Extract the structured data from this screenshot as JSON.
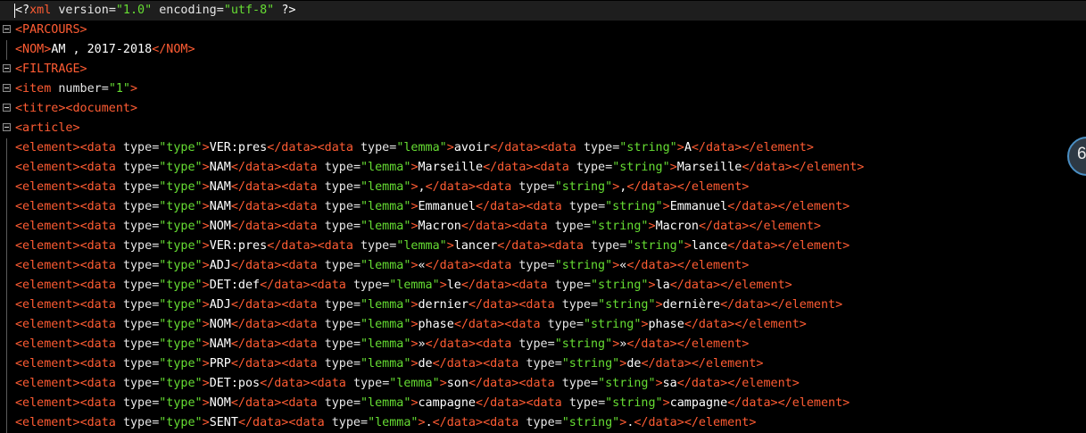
{
  "prolog": {
    "open": "<?",
    "name": "xml",
    "version_attr": "version",
    "version_val": "\"1.0\"",
    "encoding_attr": "encoding",
    "encoding_val": "\"utf-8\"",
    "close": "?>"
  },
  "parcours_tag": "<PARCOURS>",
  "nom_open": "<NOM>",
  "nom_text": "AM , 2017-2018",
  "nom_close": "</NOM>",
  "filtrage_tag": "<FILTRAGE>",
  "item": {
    "open": "<item",
    "attr": "number",
    "val": "\"1\"",
    "close": ">"
  },
  "titre_line": "<titre><document>",
  "article_tag": "<article>",
  "markup": {
    "el_open": "<element>",
    "data_open": "<data",
    "type_attr": "type",
    "type_val_type": "\"type\"",
    "type_val_lemma": "\"lemma\"",
    "type_val_string": "\"string\"",
    "gt": ">",
    "data_close": "</data>",
    "el_close": "</element>"
  },
  "elements": [
    {
      "type": "VER:pres",
      "lemma": "avoir",
      "string": "A"
    },
    {
      "type": "NAM",
      "lemma": "Marseille",
      "string": "Marseille"
    },
    {
      "type": "NAM",
      "lemma": ",",
      "string": ","
    },
    {
      "type": "NAM",
      "lemma": "Emmanuel",
      "string": "Emmanuel"
    },
    {
      "type": "NOM",
      "lemma": "Macron",
      "string": "Macron"
    },
    {
      "type": "VER:pres",
      "lemma": "lancer",
      "string": "lance"
    },
    {
      "type": "ADJ",
      "lemma": "«",
      "string": "«"
    },
    {
      "type": "DET:def",
      "lemma": "le",
      "string": "la"
    },
    {
      "type": "ADJ",
      "lemma": "dernier",
      "string": "dernière"
    },
    {
      "type": "NOM",
      "lemma": "phase",
      "string": "phase"
    },
    {
      "type": "NAM",
      "lemma": "»",
      "string": "»"
    },
    {
      "type": "PRP",
      "lemma": "de",
      "string": "de"
    },
    {
      "type": "DET:pos",
      "lemma": "son",
      "string": "sa"
    },
    {
      "type": "NOM",
      "lemma": "campagne",
      "string": "campagne"
    },
    {
      "type": "SENT",
      "lemma": ".",
      "string": "."
    }
  ],
  "badge": {
    "text": "6"
  },
  "colors": {
    "tag": "#ff5c33",
    "attr": "#e6e6e6",
    "value": "#66dd33",
    "text": "#ffffff",
    "background": "#000000"
  }
}
